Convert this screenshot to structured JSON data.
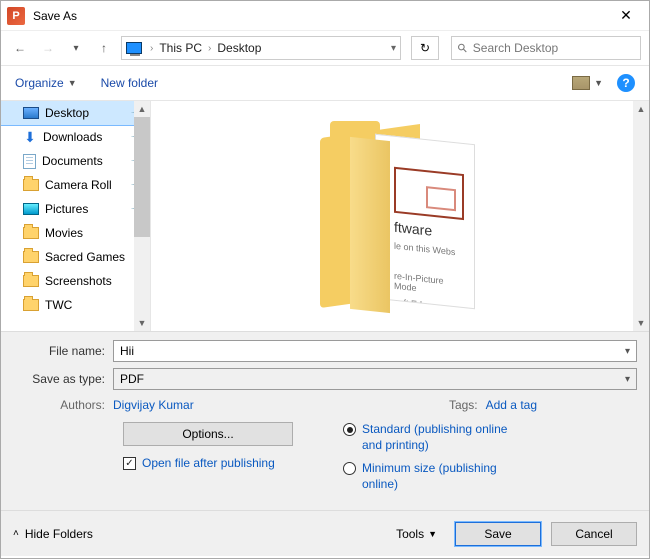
{
  "window": {
    "title": "Save As",
    "appletter": "P"
  },
  "nav": {
    "crumbs": [
      "This PC",
      "Desktop"
    ],
    "search_placeholder": "Search Desktop",
    "refresh_glyph": "↻"
  },
  "toolbar": {
    "organize": "Organize",
    "new_folder": "New folder",
    "help_glyph": "?"
  },
  "sidebar": {
    "items": [
      {
        "label": "Desktop",
        "icon": "desktop",
        "pinned": true,
        "selected": true
      },
      {
        "label": "Downloads",
        "icon": "download",
        "pinned": true
      },
      {
        "label": "Documents",
        "icon": "document",
        "pinned": true
      },
      {
        "label": "Camera Roll",
        "icon": "folder",
        "pinned": true
      },
      {
        "label": "Pictures",
        "icon": "picture",
        "pinned": true
      },
      {
        "label": "Movies",
        "icon": "folder"
      },
      {
        "label": "Sacred Games",
        "icon": "folder"
      },
      {
        "label": "Screenshots",
        "icon": "folder"
      },
      {
        "label": "TWC",
        "icon": "folder"
      }
    ]
  },
  "preview": {
    "page_snippets": [
      "ftware",
      "le on this Webs",
      "re-In-Picture Mode",
      "soft Edge Chromium"
    ]
  },
  "form": {
    "filename_label": "File name:",
    "filename_value": "Hii",
    "savetype_label": "Save as type:",
    "savetype_value": "PDF",
    "authors_label": "Authors:",
    "authors_value": "Digvijay Kumar",
    "tags_label": "Tags:",
    "tags_value": "Add a tag",
    "options_btn": "Options...",
    "open_after": "Open file after publishing",
    "radio_standard": "Standard (publishing online and printing)",
    "radio_minimum": "Minimum size (publishing online)"
  },
  "footer": {
    "hide_folders": "Hide Folders",
    "tools": "Tools",
    "save": "Save",
    "cancel": "Cancel"
  }
}
